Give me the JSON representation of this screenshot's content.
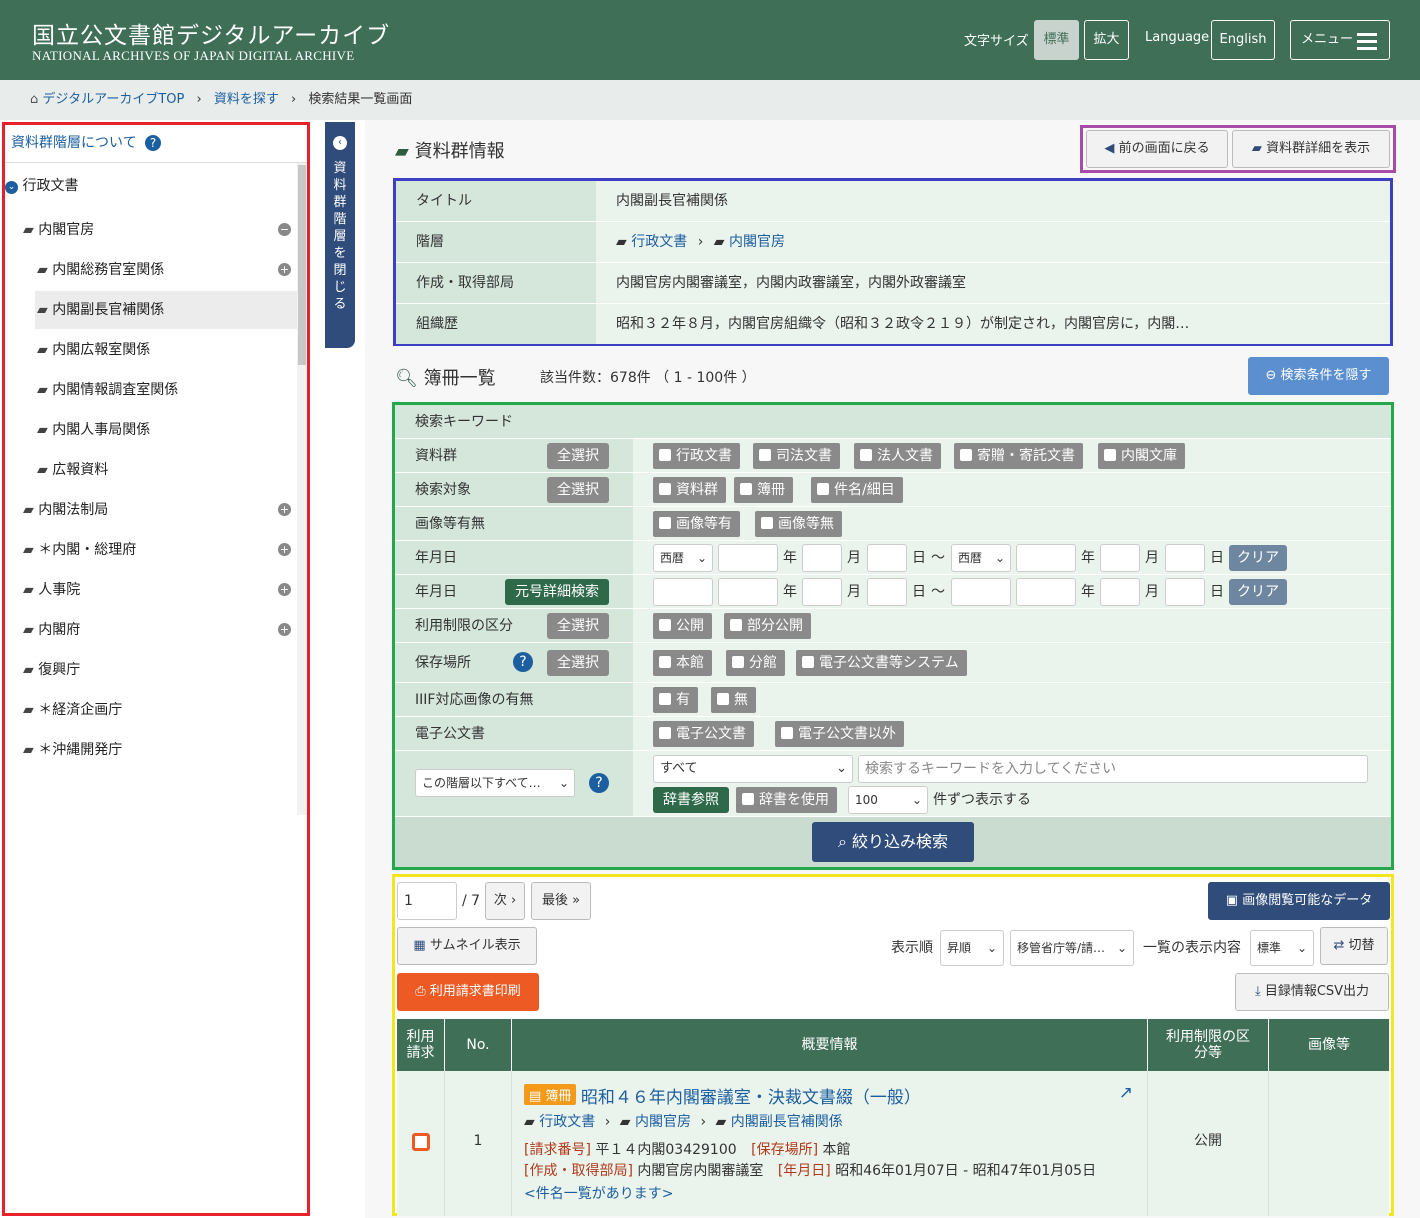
{
  "header": {
    "logo_ja": "国立公文書館デジタルアーカイブ",
    "logo_en": "NATIONAL ARCHIVES OF JAPAN  DIGITAL ARCHIVE",
    "font_size_label": "文字サイズ",
    "standard": "標準",
    "large": "拡大",
    "language_label": "Language",
    "english": "English",
    "menu": "メニュー"
  },
  "breadcrumb": {
    "home": "デジタルアーカイブTOP",
    "search": "資料を探す",
    "current": "検索結果一覧画面"
  },
  "sidebar": {
    "about": "資料群階層について",
    "root": "行政文書",
    "items": [
      {
        "label": "内閣官房",
        "level": 1,
        "toggle": "−"
      },
      {
        "label": "内閣総務官室関係",
        "level": 2,
        "toggle": "+"
      },
      {
        "label": "内閣副長官補関係",
        "level": 2,
        "toggle": "",
        "selected": true
      },
      {
        "label": "内閣広報室関係",
        "level": 2,
        "toggle": ""
      },
      {
        "label": "内閣情報調査室関係",
        "level": 2,
        "toggle": ""
      },
      {
        "label": "内閣人事局関係",
        "level": 2,
        "toggle": ""
      },
      {
        "label": "広報資料",
        "level": 2,
        "toggle": ""
      },
      {
        "label": "内閣法制局",
        "level": 1,
        "toggle": "+"
      },
      {
        "label": "＊内閣・総理府",
        "level": 1,
        "toggle": "+"
      },
      {
        "label": "人事院",
        "level": 1,
        "toggle": "+"
      },
      {
        "label": "内閣府",
        "level": 1,
        "toggle": "+"
      },
      {
        "label": "復興庁",
        "level": 1,
        "toggle": ""
      },
      {
        "label": "＊経済企画庁",
        "level": 1,
        "toggle": ""
      },
      {
        "label": "＊沖縄開発庁",
        "level": 1,
        "toggle": ""
      }
    ],
    "close_tab": "資料群階層を閉じる"
  },
  "group_info": {
    "heading": "資料群情報",
    "back_button": "前の画面に戻る",
    "detail_button": "資料群詳細を表示",
    "rows": {
      "title_label": "タイトル",
      "title_value": "内閣副長官補関係",
      "hier_label": "階層",
      "hier_1": "行政文書",
      "hier_2": "内閣官房",
      "dept_label": "作成・取得部局",
      "dept_value": "内閣官房内閣審議室，内閣内政審議室，内閣外政審議室",
      "history_label": "組織歴",
      "history_value": "昭和３２年８月，内閣官房組織令（昭和３２政令２１９）が制定され，内閣官房に，内閣…"
    }
  },
  "book_list": {
    "heading": "簿冊一覧",
    "count": "該当件数：678件 （ 1 - 100件 ）",
    "hide_button": "検索条件を隠す"
  },
  "search": {
    "keyword_label": "検索キーワード",
    "select_all": "全選択",
    "group_label": "資料群",
    "group_opts": [
      "行政文書",
      "司法文書",
      "法人文書",
      "寄贈・寄託文書",
      "内閣文庫"
    ],
    "target_label": "検索対象",
    "target_opts": [
      "資料群",
      "簿冊",
      "件名/細目"
    ],
    "image_label": "画像等有無",
    "image_opts": [
      "画像等有",
      "画像等無"
    ],
    "date_label": "年月日",
    "era": "西暦",
    "year": "年",
    "month": "月",
    "day": "日",
    "tilde": "～",
    "clear": "クリア",
    "gengo_button": "元号詳細検索",
    "restrict_label": "利用制限の区分",
    "restrict_opts": [
      "公開",
      "部分公開"
    ],
    "place_label": "保存場所",
    "place_opts": [
      "本館",
      "分館",
      "電子公文書等システム"
    ],
    "iiif_label": "IIIF対応画像の有無",
    "iiif_opts": [
      "有",
      "無"
    ],
    "edoc_label": "電子公文書",
    "edoc_opts": [
      "電子公文書",
      "電子公文書以外"
    ],
    "scope": "この階層以下すべて…",
    "field": "すべて",
    "kw_placeholder": "検索するキーワードを入力してください",
    "dict_ref": "辞書参照",
    "dict_use": "辞書を使用",
    "per_page": "100",
    "per_page_suffix": "件ずつ表示する",
    "submit": "絞り込み検索"
  },
  "results": {
    "page": "1",
    "total_pages": "/ 7",
    "next": "次",
    "last": "最後",
    "image_data": "画像閲覧可能なデータ",
    "thumb": "サムネイル表示",
    "order_label": "表示順",
    "order": "昇順",
    "sort_by": "移管省庁等/請…",
    "display_label": "一覧の表示内容",
    "display": "標準",
    "switch": "切替",
    "print": "利用請求書印刷",
    "csv": "目録情報CSV出力",
    "headers": [
      "利用請求",
      "No.",
      "概要情報",
      "利用制限の区分等",
      "画像等"
    ],
    "row": {
      "no": "1",
      "badge": "簿冊",
      "title": "昭和４６年内閣審議室・決裁文書綴（一般）",
      "path": [
        "行政文書",
        "内閣官房",
        "内閣副長官補関係"
      ],
      "req_label": "[請求番号]",
      "req": "平１４内閣03429100",
      "place_label": "[保存場所]",
      "place": "本館",
      "dept_label": "[作成・取得部局]",
      "dept": "内閣官房内閣審議室",
      "date_label": "[年月日]",
      "date": "昭和46年01月07日 - 昭和47年01月05日",
      "subitems": "<件名一覧があります>",
      "restriction": "公開"
    }
  },
  "colors": {
    "header": "#3f6f57",
    "red_box": "#e8202a",
    "blue_box": "#3c3fc4",
    "purple_box": "#a64ca6",
    "green_box": "#24a84b",
    "yellow_box": "#f4e61e",
    "accent_blue": "#1c5fa0"
  }
}
